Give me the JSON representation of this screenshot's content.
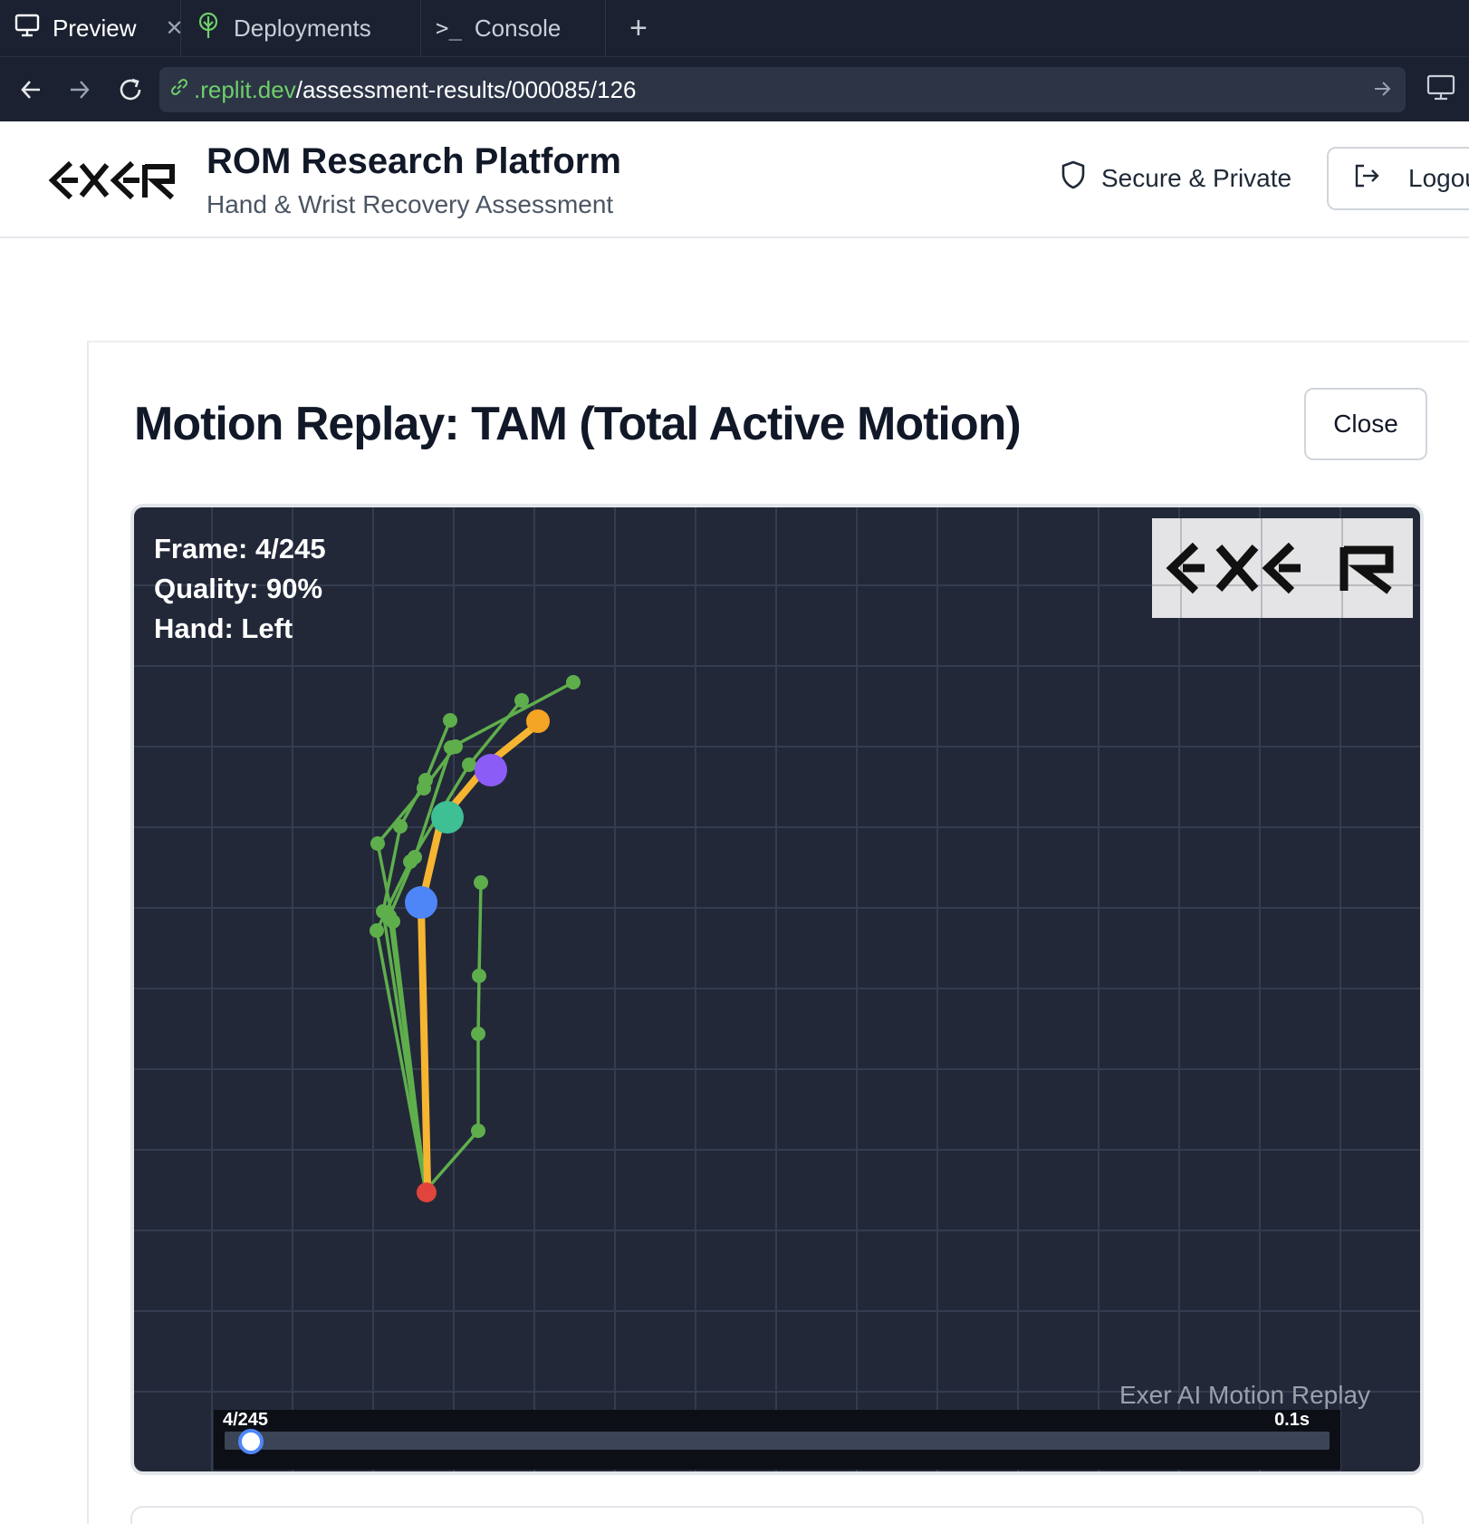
{
  "browser": {
    "tabs": [
      {
        "label": "Preview",
        "icon": "monitor-icon",
        "active": true
      },
      {
        "label": "Deployments",
        "icon": "deploy-icon",
        "active": false
      },
      {
        "label": "Console",
        "icon": "terminal-icon",
        "active": false
      }
    ],
    "url": {
      "host": ".replit.dev",
      "path": "/assessment-results/000085/126"
    }
  },
  "header": {
    "title": "ROM Research Platform",
    "subtitle": "Hand & Wrist Recovery Assessment",
    "secure_label": "Secure & Private",
    "logout_label": "Logou"
  },
  "modal": {
    "title": "Motion Replay: TAM (Total Active Motion)",
    "close_label": "Close",
    "overlay": {
      "frame": "Frame: 4/245",
      "quality": "Quality: 90%",
      "hand": "Hand: Left"
    },
    "caption": "Exer AI Motion Replay",
    "timeline": {
      "frame_label": "4/245",
      "time_label": "0.1s",
      "current_frame": 4,
      "total_frames": 245
    }
  },
  "colors": {
    "skeleton": "#5fae4c",
    "highlight_finger": "#f6b531",
    "wrist": "#e0443c",
    "joint_blue": "#4f86f7",
    "joint_purple": "#8b5cf6",
    "joint_teal": "#3fbf94",
    "tip_orange": "#f5a524"
  }
}
